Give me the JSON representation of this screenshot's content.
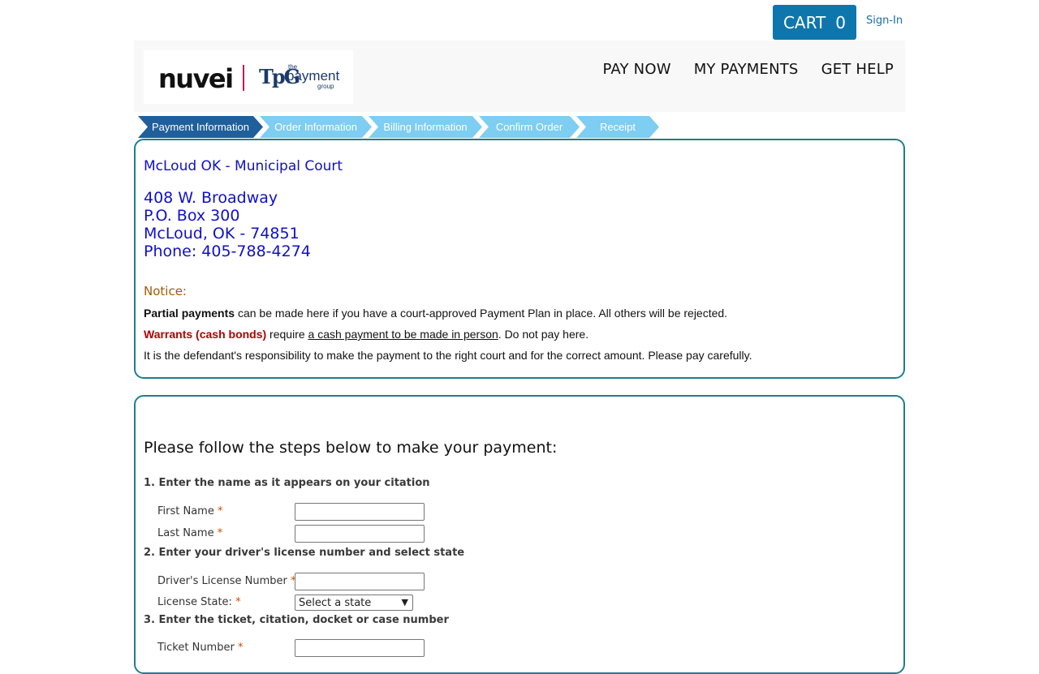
{
  "topbar": {
    "cart_label": "CART",
    "cart_count": "0",
    "signin_label": "Sign-In"
  },
  "logo": {
    "brand": "nuvei",
    "partner_mark": "TpG",
    "partner_the": "the",
    "partner_name": "payment",
    "partner_group": "group"
  },
  "nav": {
    "pay_now": "PAY NOW",
    "my_payments": "MY PAYMENTS",
    "get_help": "GET HELP"
  },
  "steps": [
    {
      "label": "Payment Information",
      "state": "active"
    },
    {
      "label": "Order Information",
      "state": "pending"
    },
    {
      "label": "Billing Information",
      "state": "pending"
    },
    {
      "label": "Confirm Order",
      "state": "pending"
    },
    {
      "label": "Receipt",
      "state": "pending"
    }
  ],
  "court": {
    "name": "McLoud OK - Municipal Court",
    "address_line1": "408 W. Broadway",
    "address_line2": "P.O. Box 300",
    "address_line3": "McLoud, OK - 74851",
    "phone": "Phone: 405-788-4274"
  },
  "notice": {
    "title": "Notice:",
    "partial_bold": "Partial payments",
    "partial_rest": " can be made here if you have a court-approved Payment Plan in place. All others will be rejected.",
    "warrants_bold": "Warrants (cash bonds)",
    "warrants_mid": " require ",
    "warrants_link": "a cash payment to be made in person",
    "warrants_end": ". Do not pay here.",
    "responsibility": "It is the defendant's responsibility to make the payment to the right court and for the correct amount. Please pay carefully."
  },
  "form": {
    "title": "Please follow the steps below to make your payment:",
    "step1_label": "1. Enter the name as it appears on your citation",
    "first_name_label": "First Name",
    "last_name_label": "Last Name",
    "step2_label": "2. Enter your driver's license number and select state",
    "license_number_label": "Driver's License Number",
    "license_state_label": "License State:",
    "license_state_value": "Select a state",
    "step3_label": "3. Enter the ticket, citation, docket or case number",
    "ticket_number_label": "Ticket Number",
    "required_marker": "*"
  },
  "colors": {
    "cart_bg": "#0d77ad",
    "step_active": "#1f5f9c",
    "step_pending": "#7ecdf2",
    "card_border": "#1d7e8f",
    "court_text": "#1010c8",
    "notice_title": "#a35c00",
    "warning_text": "#b00000",
    "required": "#d04a02"
  }
}
